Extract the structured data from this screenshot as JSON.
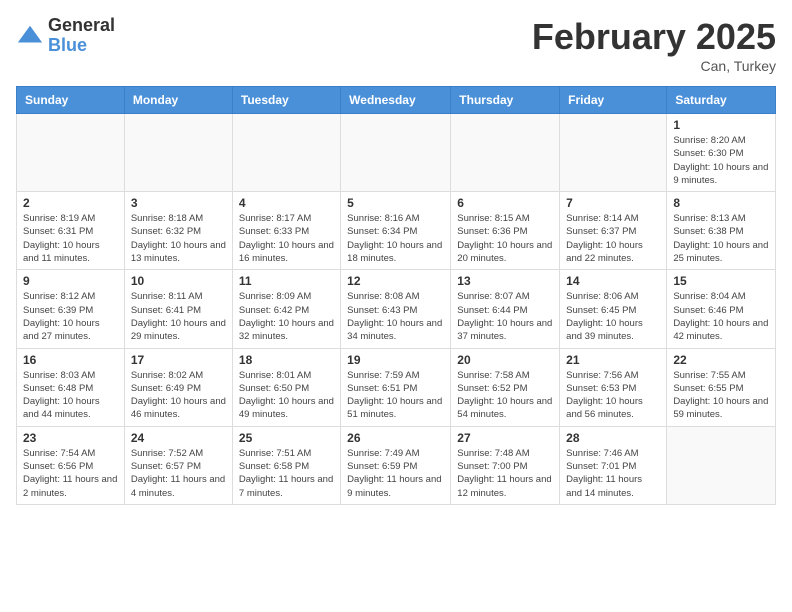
{
  "logo": {
    "general": "General",
    "blue": "Blue"
  },
  "title": "February 2025",
  "subtitle": "Can, Turkey",
  "days_of_week": [
    "Sunday",
    "Monday",
    "Tuesday",
    "Wednesday",
    "Thursday",
    "Friday",
    "Saturday"
  ],
  "weeks": [
    [
      {
        "day": "",
        "info": ""
      },
      {
        "day": "",
        "info": ""
      },
      {
        "day": "",
        "info": ""
      },
      {
        "day": "",
        "info": ""
      },
      {
        "day": "",
        "info": ""
      },
      {
        "day": "",
        "info": ""
      },
      {
        "day": "1",
        "info": "Sunrise: 8:20 AM\nSunset: 6:30 PM\nDaylight: 10 hours and 9 minutes."
      }
    ],
    [
      {
        "day": "2",
        "info": "Sunrise: 8:19 AM\nSunset: 6:31 PM\nDaylight: 10 hours and 11 minutes."
      },
      {
        "day": "3",
        "info": "Sunrise: 8:18 AM\nSunset: 6:32 PM\nDaylight: 10 hours and 13 minutes."
      },
      {
        "day": "4",
        "info": "Sunrise: 8:17 AM\nSunset: 6:33 PM\nDaylight: 10 hours and 16 minutes."
      },
      {
        "day": "5",
        "info": "Sunrise: 8:16 AM\nSunset: 6:34 PM\nDaylight: 10 hours and 18 minutes."
      },
      {
        "day": "6",
        "info": "Sunrise: 8:15 AM\nSunset: 6:36 PM\nDaylight: 10 hours and 20 minutes."
      },
      {
        "day": "7",
        "info": "Sunrise: 8:14 AM\nSunset: 6:37 PM\nDaylight: 10 hours and 22 minutes."
      },
      {
        "day": "8",
        "info": "Sunrise: 8:13 AM\nSunset: 6:38 PM\nDaylight: 10 hours and 25 minutes."
      }
    ],
    [
      {
        "day": "9",
        "info": "Sunrise: 8:12 AM\nSunset: 6:39 PM\nDaylight: 10 hours and 27 minutes."
      },
      {
        "day": "10",
        "info": "Sunrise: 8:11 AM\nSunset: 6:41 PM\nDaylight: 10 hours and 29 minutes."
      },
      {
        "day": "11",
        "info": "Sunrise: 8:09 AM\nSunset: 6:42 PM\nDaylight: 10 hours and 32 minutes."
      },
      {
        "day": "12",
        "info": "Sunrise: 8:08 AM\nSunset: 6:43 PM\nDaylight: 10 hours and 34 minutes."
      },
      {
        "day": "13",
        "info": "Sunrise: 8:07 AM\nSunset: 6:44 PM\nDaylight: 10 hours and 37 minutes."
      },
      {
        "day": "14",
        "info": "Sunrise: 8:06 AM\nSunset: 6:45 PM\nDaylight: 10 hours and 39 minutes."
      },
      {
        "day": "15",
        "info": "Sunrise: 8:04 AM\nSunset: 6:46 PM\nDaylight: 10 hours and 42 minutes."
      }
    ],
    [
      {
        "day": "16",
        "info": "Sunrise: 8:03 AM\nSunset: 6:48 PM\nDaylight: 10 hours and 44 minutes."
      },
      {
        "day": "17",
        "info": "Sunrise: 8:02 AM\nSunset: 6:49 PM\nDaylight: 10 hours and 46 minutes."
      },
      {
        "day": "18",
        "info": "Sunrise: 8:01 AM\nSunset: 6:50 PM\nDaylight: 10 hours and 49 minutes."
      },
      {
        "day": "19",
        "info": "Sunrise: 7:59 AM\nSunset: 6:51 PM\nDaylight: 10 hours and 51 minutes."
      },
      {
        "day": "20",
        "info": "Sunrise: 7:58 AM\nSunset: 6:52 PM\nDaylight: 10 hours and 54 minutes."
      },
      {
        "day": "21",
        "info": "Sunrise: 7:56 AM\nSunset: 6:53 PM\nDaylight: 10 hours and 56 minutes."
      },
      {
        "day": "22",
        "info": "Sunrise: 7:55 AM\nSunset: 6:55 PM\nDaylight: 10 hours and 59 minutes."
      }
    ],
    [
      {
        "day": "23",
        "info": "Sunrise: 7:54 AM\nSunset: 6:56 PM\nDaylight: 11 hours and 2 minutes."
      },
      {
        "day": "24",
        "info": "Sunrise: 7:52 AM\nSunset: 6:57 PM\nDaylight: 11 hours and 4 minutes."
      },
      {
        "day": "25",
        "info": "Sunrise: 7:51 AM\nSunset: 6:58 PM\nDaylight: 11 hours and 7 minutes."
      },
      {
        "day": "26",
        "info": "Sunrise: 7:49 AM\nSunset: 6:59 PM\nDaylight: 11 hours and 9 minutes."
      },
      {
        "day": "27",
        "info": "Sunrise: 7:48 AM\nSunset: 7:00 PM\nDaylight: 11 hours and 12 minutes."
      },
      {
        "day": "28",
        "info": "Sunrise: 7:46 AM\nSunset: 7:01 PM\nDaylight: 11 hours and 14 minutes."
      },
      {
        "day": "",
        "info": ""
      }
    ]
  ]
}
